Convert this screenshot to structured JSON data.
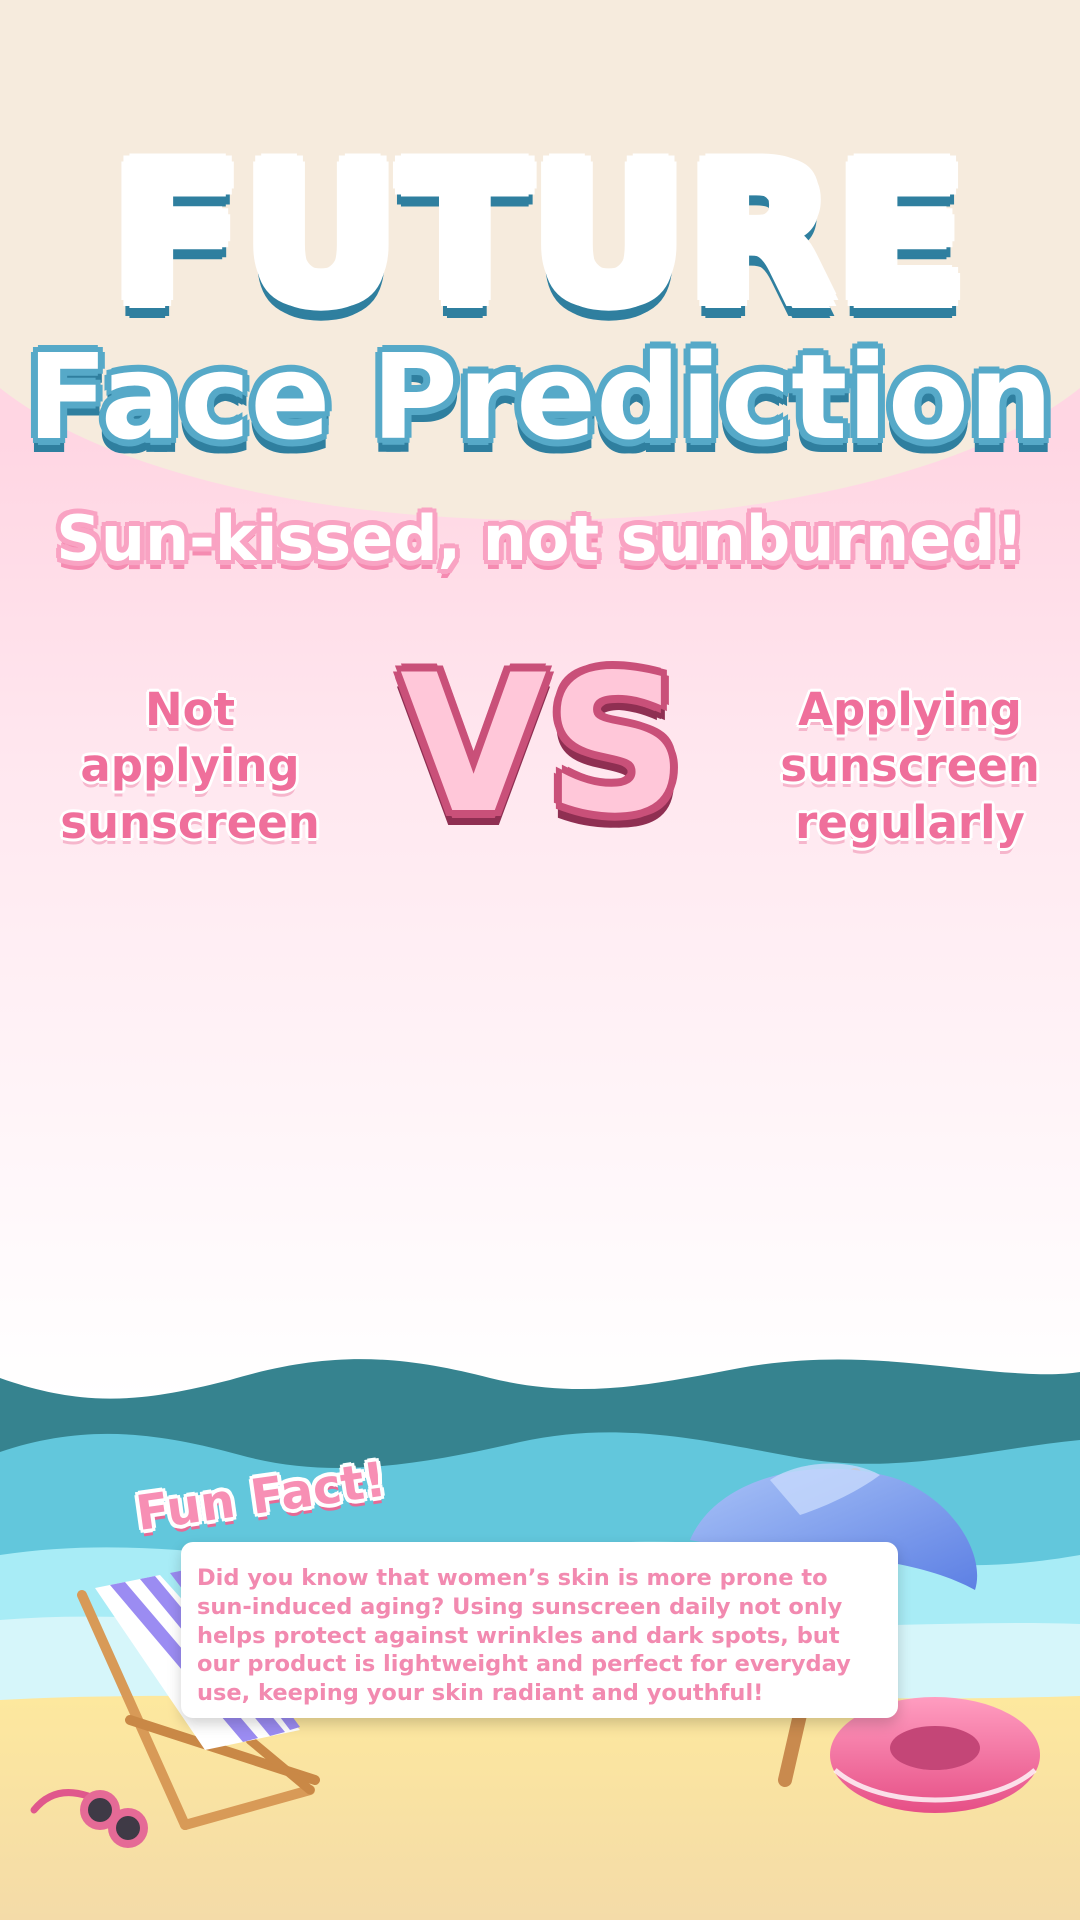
{
  "header": {
    "title_line1": "FUTURE",
    "title_line2": "Face Prediction",
    "subtitle": "Sun-kissed, not sunburned!"
  },
  "comparison": {
    "left_label": "Not applying sunscreen",
    "vs_label": "VS",
    "right_label": "Applying sunscreen regularly"
  },
  "fun_fact": {
    "tag": "Fun Fact!",
    "text": "Did you know that women’s skin is more prone to sun-induced aging? Using sunscreen daily not only helps protect against wrinkles and dark spots, but our product is lightweight and perfect for everyday use, keeping your skin radiant and youthful!"
  },
  "colors": {
    "title_blue": "#56a9c8",
    "title_dark_blue": "#2f7f9f",
    "pink_text": "#ef6f9b",
    "vs_dark": "#c95079",
    "background_top": "#f6ebdd",
    "background_pink": "#ffd6e3"
  },
  "icons": [
    "beach-chair-icon",
    "sunglasses-icon",
    "beach-umbrella-icon",
    "swim-ring-icon"
  ]
}
